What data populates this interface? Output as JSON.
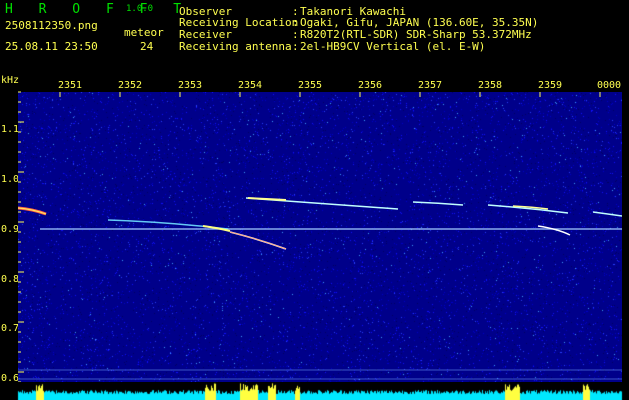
{
  "header": {
    "app_title": "H R O F F T",
    "version": "1.0.0",
    "filename": "2508112350.png",
    "datetime": "25.08.11 23:50",
    "meteor_label": "meteor",
    "meteor_count": "24",
    "rows": [
      {
        "label": "Observer",
        "sep": ":",
        "value": "Takanori Kawachi"
      },
      {
        "label": "Receiving Location",
        "sep": ":",
        "value": "Ogaki, Gifu, JAPAN (136.60E, 35.35N)"
      },
      {
        "label": "Receiver",
        "sep": ":",
        "value": "R820T2(RTL-SDR) SDR-Sharp 53.372MHz"
      },
      {
        "label": "Receiving antenna",
        "sep": ":",
        "value": "2el-HB9CV Vertical (el. E-W)"
      }
    ]
  },
  "axes": {
    "freq_unit": "kHz",
    "time_ticks": [
      "2351",
      "2352",
      "2353",
      "2354",
      "2355",
      "2356",
      "2357",
      "2358",
      "2359",
      "0000"
    ],
    "freq_ticks": [
      "1.1",
      "1.0",
      "0.9",
      "0.8",
      "0.7",
      "0.6"
    ]
  },
  "colors": {
    "background": "#000000",
    "plot_background": "#00008a",
    "label_yellow": "#ffff50",
    "title_green": "#00e000",
    "trace_cyan": "#40ffff",
    "signal_level": "#00e8ff"
  }
}
